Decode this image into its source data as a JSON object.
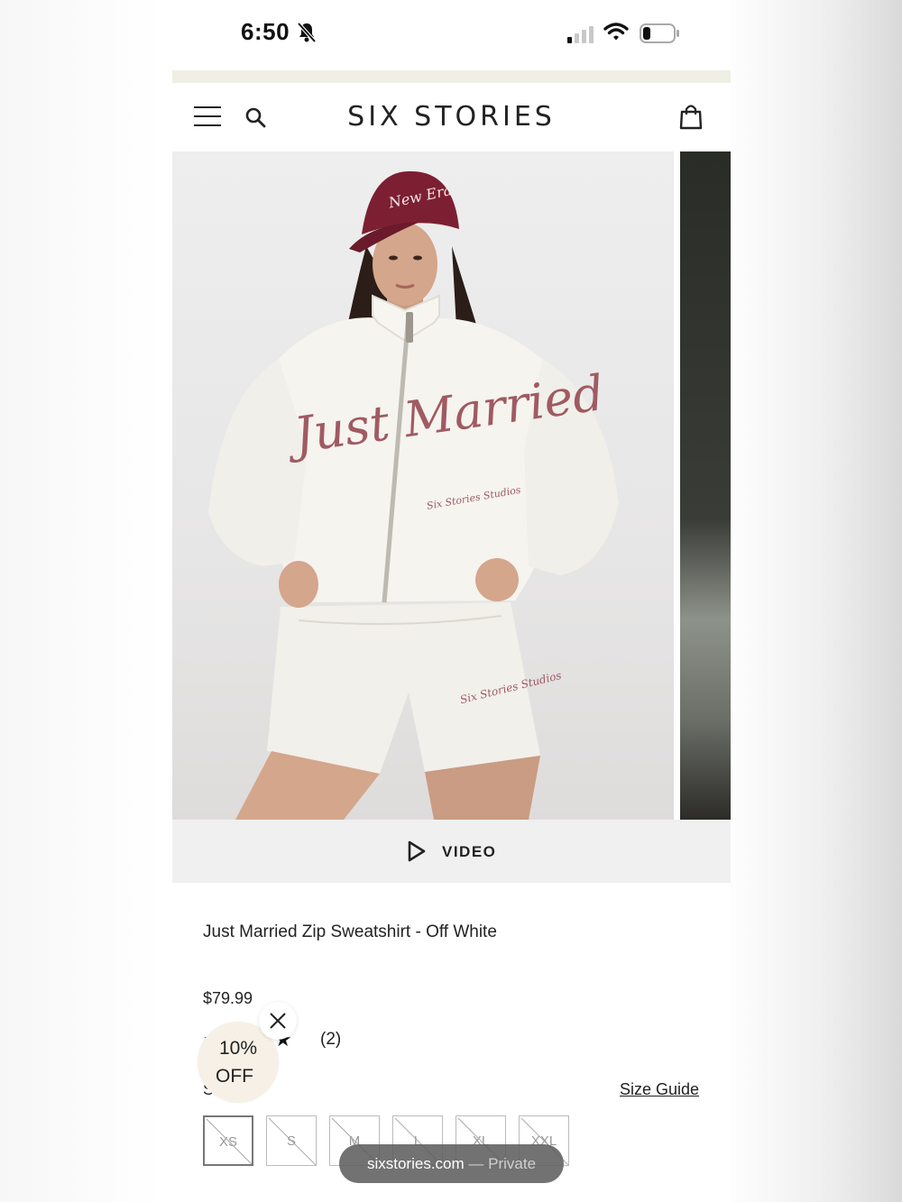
{
  "status_bar": {
    "time": "6:50",
    "icons": [
      "bell-off-icon",
      "cellular-signal-icon",
      "wifi-icon",
      "battery-icon"
    ]
  },
  "header": {
    "brand": "SIX STORIES",
    "icons": [
      "menu-icon",
      "search-icon",
      "shopping-bag-icon"
    ]
  },
  "gallery": {
    "video_label": "VIDEO",
    "hat_text": "New Era",
    "jacket_script": "Just Married",
    "jacket_small_script": "Six Stories Studios",
    "shorts_script": "Six Stories Studios"
  },
  "product": {
    "title": "Just Married Zip Sweatshirt - Off White",
    "price": "$79.99",
    "stars": "★★★★★",
    "review_count": "(2)",
    "rating": 5,
    "size_label": "Size",
    "size_guide": "Size Guide",
    "sizes": [
      "XS",
      "S",
      "M",
      "L",
      "XL",
      "XXL"
    ],
    "selected_size": "XS"
  },
  "discount_popup": {
    "line1": "10%",
    "line2": "OFF"
  },
  "browser": {
    "domain": "sixstories.com",
    "mode": "— Private"
  },
  "colors": {
    "promo_bar": "#efefe6",
    "hat": "#7d1f33",
    "script": "#a05a62",
    "discount_bg": "#f6f0e6"
  }
}
